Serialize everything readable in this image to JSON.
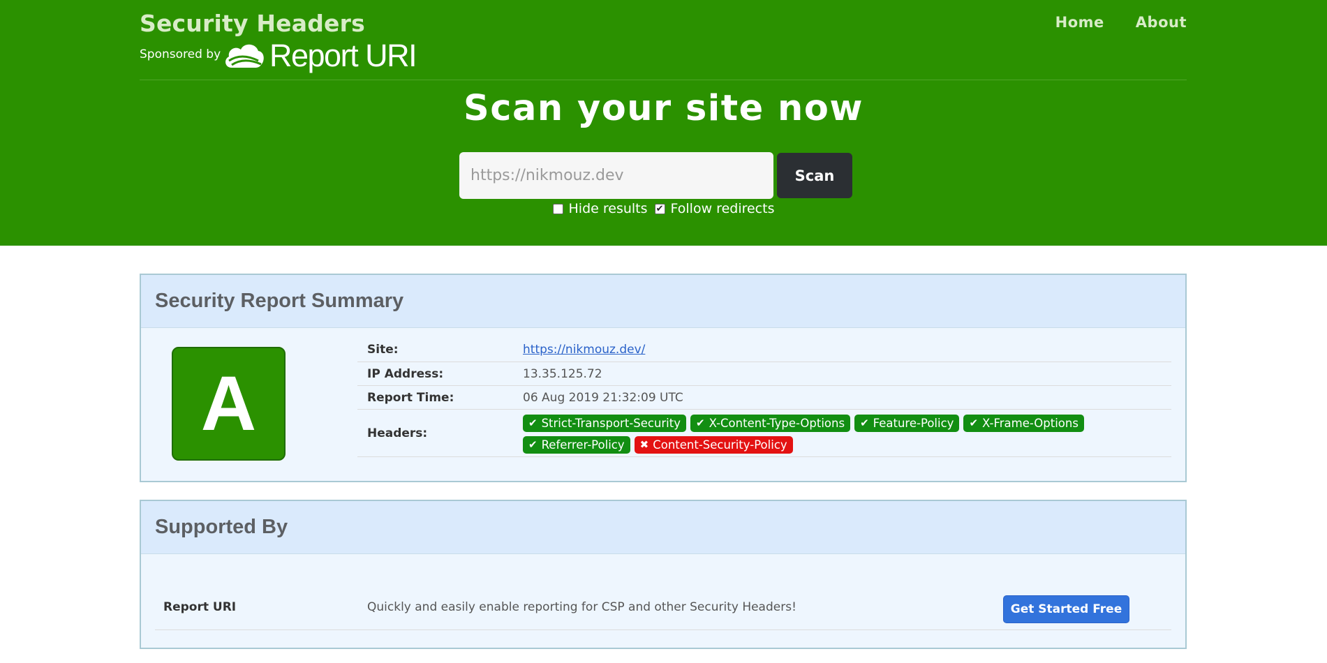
{
  "header": {
    "title": "Security Headers",
    "sponsored_by": "Sponsored by",
    "logo_text": "Report URI",
    "nav": [
      "Home",
      "About"
    ]
  },
  "scan": {
    "heading": "Scan your site now",
    "input_value": "",
    "input_placeholder": "https://nikmouz.dev",
    "button_label": "Scan",
    "options": [
      {
        "label": "Hide results",
        "checked": false
      },
      {
        "label": "Follow redirects",
        "checked": true
      }
    ]
  },
  "summary": {
    "title": "Security Report Summary",
    "grade": "A",
    "site_label": "Site:",
    "site_value": "https://nikmouz.dev/",
    "ip_label": "IP Address:",
    "ip_value": "13.35.125.72",
    "time_label": "Report Time:",
    "time_value": "06 Aug 2019 21:32:09 UTC",
    "headers_label": "Headers:",
    "headers": [
      {
        "name": "Strict-Transport-Security",
        "status": "pass",
        "icon": "✔"
      },
      {
        "name": "X-Content-Type-Options",
        "status": "pass",
        "icon": "✔"
      },
      {
        "name": "Feature-Policy",
        "status": "pass",
        "icon": "✔"
      },
      {
        "name": "X-Frame-Options",
        "status": "pass",
        "icon": "✔"
      },
      {
        "name": "Referrer-Policy",
        "status": "pass",
        "icon": "✔"
      },
      {
        "name": "Content-Security-Policy",
        "status": "fail",
        "icon": "✖"
      }
    ]
  },
  "supported": {
    "title": "Supported By",
    "name": "Report URI",
    "description": "Quickly and easily enable reporting for CSP and other Security Headers!",
    "button_label": "Get Started Free"
  },
  "colors": {
    "header_bg": "#2b9100",
    "pass": "#128e12",
    "fail": "#e31212",
    "primary_button": "#3273dc"
  }
}
